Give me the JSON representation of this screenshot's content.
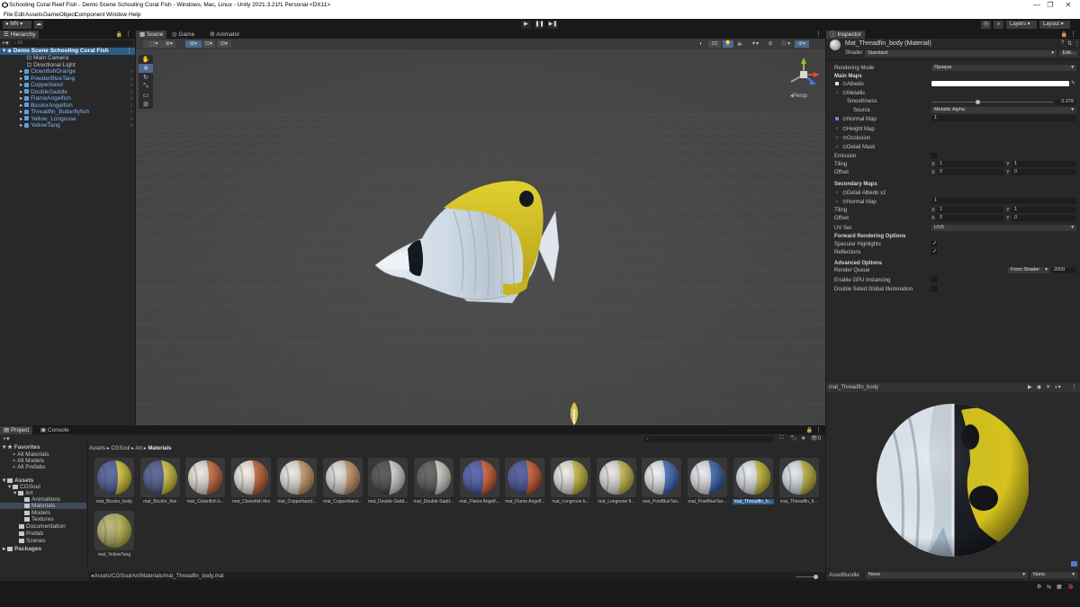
{
  "window": {
    "title": "Schooling Coral Reef Fish - Demo Scene Schooling Coral Fish - Windows, Mac, Linux - Unity 2021.3.21f1 Personal <DX11>",
    "controls": [
      "—",
      "❐",
      "✕"
    ]
  },
  "menu": [
    "File",
    "Edit",
    "Assets",
    "GameObject",
    "Component",
    "Window",
    "Help"
  ],
  "toolbar": {
    "account": "MN",
    "layers_label": "Layers",
    "layout_label": "Layout"
  },
  "hierarchy": {
    "tab": "Hierarchy",
    "search_placeholder": "All",
    "scene_name": "Demo Scene Schooling Coral Fish",
    "items": [
      {
        "label": "Main Camera",
        "prefab": false,
        "expandable": false
      },
      {
        "label": "Directional Light",
        "prefab": false,
        "expandable": false
      },
      {
        "label": "ClownfishOrange",
        "prefab": true,
        "expandable": true
      },
      {
        "label": "PowderBlueTang",
        "prefab": true,
        "expandable": true
      },
      {
        "label": "Copperband",
        "prefab": true,
        "expandable": true
      },
      {
        "label": "DoubleSaddle",
        "prefab": true,
        "expandable": true
      },
      {
        "label": "FlameAngelfish",
        "prefab": true,
        "expandable": true
      },
      {
        "label": "BicolorAngelfish",
        "prefab": true,
        "expandable": true
      },
      {
        "label": "Threadfin_Butterflyfish",
        "prefab": true,
        "expandable": true
      },
      {
        "label": "Yellow_Longnose",
        "prefab": true,
        "expandable": true
      },
      {
        "label": "YellowTang",
        "prefab": true,
        "expandable": true
      }
    ]
  },
  "scene": {
    "tabs": [
      "Scene",
      "Game",
      "Animator"
    ],
    "mode_2d": "2D",
    "persp_label": "Persp"
  },
  "inspector": {
    "tab": "Inspector",
    "material_name": "Mat_Threadfin_body (Material)",
    "shader_label": "Shader",
    "shader_value": "Standard",
    "edit_button": "Edit...",
    "rendering_mode_label": "Rendering Mode",
    "rendering_mode_value": "Opaque",
    "main_maps": "Main Maps",
    "albedo": "Albedo",
    "metallic": "Metallic",
    "smoothness": "Smoothness",
    "smoothness_value": "0.378",
    "smoothness_fraction": 0.378,
    "source": "Source",
    "source_value": "Metallic Alpha",
    "normal_map": "Normal Map",
    "normal_value": "1",
    "height_map": "Height Map",
    "occlusion": "Occlusion",
    "detail_mask": "Detail Mask",
    "emission": "Emission",
    "tiling": "Tiling",
    "offset": "Offset",
    "x": "X",
    "y": "Y",
    "tiling_x": "1",
    "tiling_y": "1",
    "offset_x": "0",
    "offset_y": "0",
    "secondary_maps": "Secondary Maps",
    "detail_albedo": "Detail Albedo x2",
    "normal_map2": "Normal Map",
    "normal_value2": "1",
    "tiling2_x": "1",
    "tiling2_y": "1",
    "offset2_x": "0",
    "offset2_y": "0",
    "uv_set": "UV Set",
    "uv_set_value": "UV0",
    "forward_options": "Forward Rendering Options",
    "specular": "Specular Highlights",
    "reflections": "Reflections",
    "advanced": "Advanced Options",
    "render_queue": "Render Queue",
    "render_queue_mode": "From Shader",
    "render_queue_value": "2000",
    "gpu_instancing": "Enable GPU Instancing",
    "double_sided": "Double Sided Global Illumination",
    "preview_title": "mat_Threadfin_body",
    "assetbundle_label": "AssetBundle",
    "assetbundle_value": "None",
    "assetbundle_variant": "None"
  },
  "project": {
    "tabs": [
      "Project",
      "Console"
    ],
    "favorites": "Favorites",
    "fav_items": [
      "All Materials",
      "All Models",
      "All Prefabs"
    ],
    "assets": "Assets",
    "tree": [
      "CGSoul",
      "Art",
      "Animations",
      "Materials",
      "Models",
      "Textures",
      "Documentation",
      "Prefab",
      "Scenes"
    ],
    "packages": "Packages",
    "breadcrumb": [
      "Assets",
      "CGSoul",
      "Art",
      "Materials"
    ],
    "badge_count": "0",
    "path": "Assets/CGSoul/Art/Materials/mat_Threadfin_body.mat",
    "materials": [
      {
        "label": "mat_Bicolor_body",
        "c1": "#e8d21e",
        "c2": "#2a3e8a"
      },
      {
        "label": "mat_Bicolor_fins",
        "c1": "#e6cf2a",
        "c2": "#2d3a7c"
      },
      {
        "label": "mat_Clownfish b...",
        "c1": "#d9622a",
        "c2": "#e8e0d8"
      },
      {
        "label": "mat_Clownfish fins",
        "c1": "#cf5a24",
        "c2": "#efe6dd"
      },
      {
        "label": "mat_Copperband...",
        "c1": "#d8a060",
        "c2": "#e6e2dc"
      },
      {
        "label": "mat_Copperband...",
        "c1": "#d49a58",
        "c2": "#dcd8d2"
      },
      {
        "label": "mat_Double-Sadd...",
        "c1": "#e9e6e0",
        "c2": "#2a2a2a"
      },
      {
        "label": "mat_Double-Sadd...",
        "c1": "#e3e0da",
        "c2": "#3a3a3a"
      },
      {
        "label": "mat_Flame Angelf...",
        "c1": "#e0521e",
        "c2": "#2b3c9a"
      },
      {
        "label": "mat_Flame Angelf...",
        "c1": "#d84c1c",
        "c2": "#24348a"
      },
      {
        "label": "mat_Longnose b...",
        "c1": "#d7c52a",
        "c2": "#e8e4de"
      },
      {
        "label": "mat_Longnose fi...",
        "c1": "#d8c83a",
        "c2": "#e2dfd9"
      },
      {
        "label": "mat_PowBlueTan...",
        "c1": "#2a62c6",
        "c2": "#e6e9ef"
      },
      {
        "label": "mat_PowBlueTan...",
        "c1": "#2458ba",
        "c2": "#e0e3ea"
      },
      {
        "label": "mat_Threadfin_b...",
        "c1": "#d9c520",
        "c2": "#dfe5ec"
      },
      {
        "label": "mat_Threadfin_fi...",
        "c1": "#d0bd28",
        "c2": "#dae0e6"
      },
      {
        "label": "mat_YellowTang",
        "c1": "#c9c23a",
        "c2": "#a8a450"
      }
    ],
    "selected_index": 14
  },
  "colors": {
    "accent": "#2c5d87",
    "prefab_blue": "#7cb5ff",
    "fish_yellow": "#d8c41e",
    "fish_white": "#e4ebf2",
    "fish_black": "#141820"
  }
}
